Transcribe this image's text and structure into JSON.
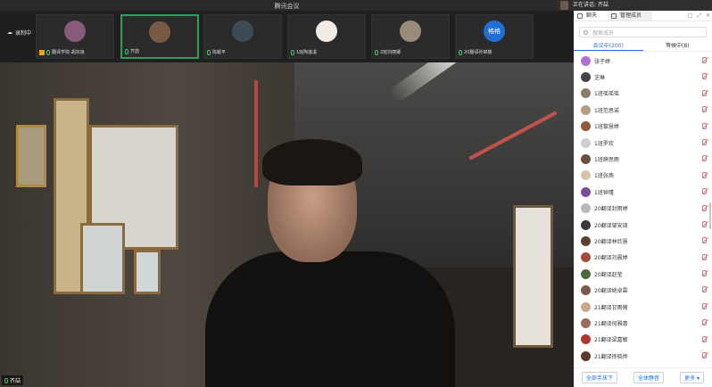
{
  "window": {
    "title": "腾讯会议"
  },
  "speaking": {
    "text": "正在讲话: 齐喆"
  },
  "window_controls": [
    "—",
    "□",
    "✕"
  ],
  "recording": {
    "label": "录制中"
  },
  "participants_strip": [
    {
      "name": "翻译学院-胡宗良"
    },
    {
      "name": "齐喆"
    },
    {
      "name": "陈鲲平"
    },
    {
      "name": "1班陶莲溪"
    },
    {
      "name": "2班刘丽娜"
    },
    {
      "name": "20翻译孙锦格",
      "avatar_text": "格格"
    }
  ],
  "main_video": {
    "speaker_label": "齐喆"
  },
  "sidebar": {
    "tabs": [
      "聊天",
      "管理成员"
    ],
    "controls": [
      "□",
      "⤢",
      "✕"
    ],
    "search_placeholder": "搜索成员",
    "member_tabs": [
      "会议中(200)",
      "等候中(8)"
    ],
    "members": [
      {
        "name": "张子婷",
        "color": "#b26fd8"
      },
      {
        "name": "芝琳",
        "color": "#444444"
      },
      {
        "name": "1班瑶瑶瑶",
        "color": "#8a7b6d"
      },
      {
        "name": "1班范思诺",
        "color": "#b59c85"
      },
      {
        "name": "1班黎慧婷",
        "color": "#8d5a3b"
      },
      {
        "name": "1班罗欢",
        "color": "#cfcfcf"
      },
      {
        "name": "1班薛思雨",
        "color": "#6a4f3a"
      },
      {
        "name": "1班张燕",
        "color": "#d8c3a9"
      },
      {
        "name": "1班钟瑾",
        "color": "#7a4d9a"
      },
      {
        "name": "20翻译封雨婷",
        "color": "#b8b8b8"
      },
      {
        "name": "20翻译邹安琦",
        "color": "#3a3a3a"
      },
      {
        "name": "20翻译林欣慧",
        "color": "#5c4030"
      },
      {
        "name": "20翻译刘晨婷",
        "color": "#a54a3a"
      },
      {
        "name": "20翻译赵莹",
        "color": "#4a6a3a"
      },
      {
        "name": "20翻译姚卓霖",
        "color": "#7a5a4a"
      },
      {
        "name": "21翻译甘雨薇",
        "color": "#caa98a"
      },
      {
        "name": "21翻译何雅惠",
        "color": "#9a6a5a"
      },
      {
        "name": "21翻译梁嘉敏",
        "color": "#b2342f"
      },
      {
        "name": "21翻译徐晓烨",
        "color": "#5a3a2a"
      }
    ],
    "footer_buttons": [
      "全部手放下",
      "全体静音",
      "更多 ▾"
    ]
  },
  "colors": {
    "active_border": "#2aa15a",
    "accent": "#1f6fd6",
    "mute_red": "#e06a6a"
  }
}
